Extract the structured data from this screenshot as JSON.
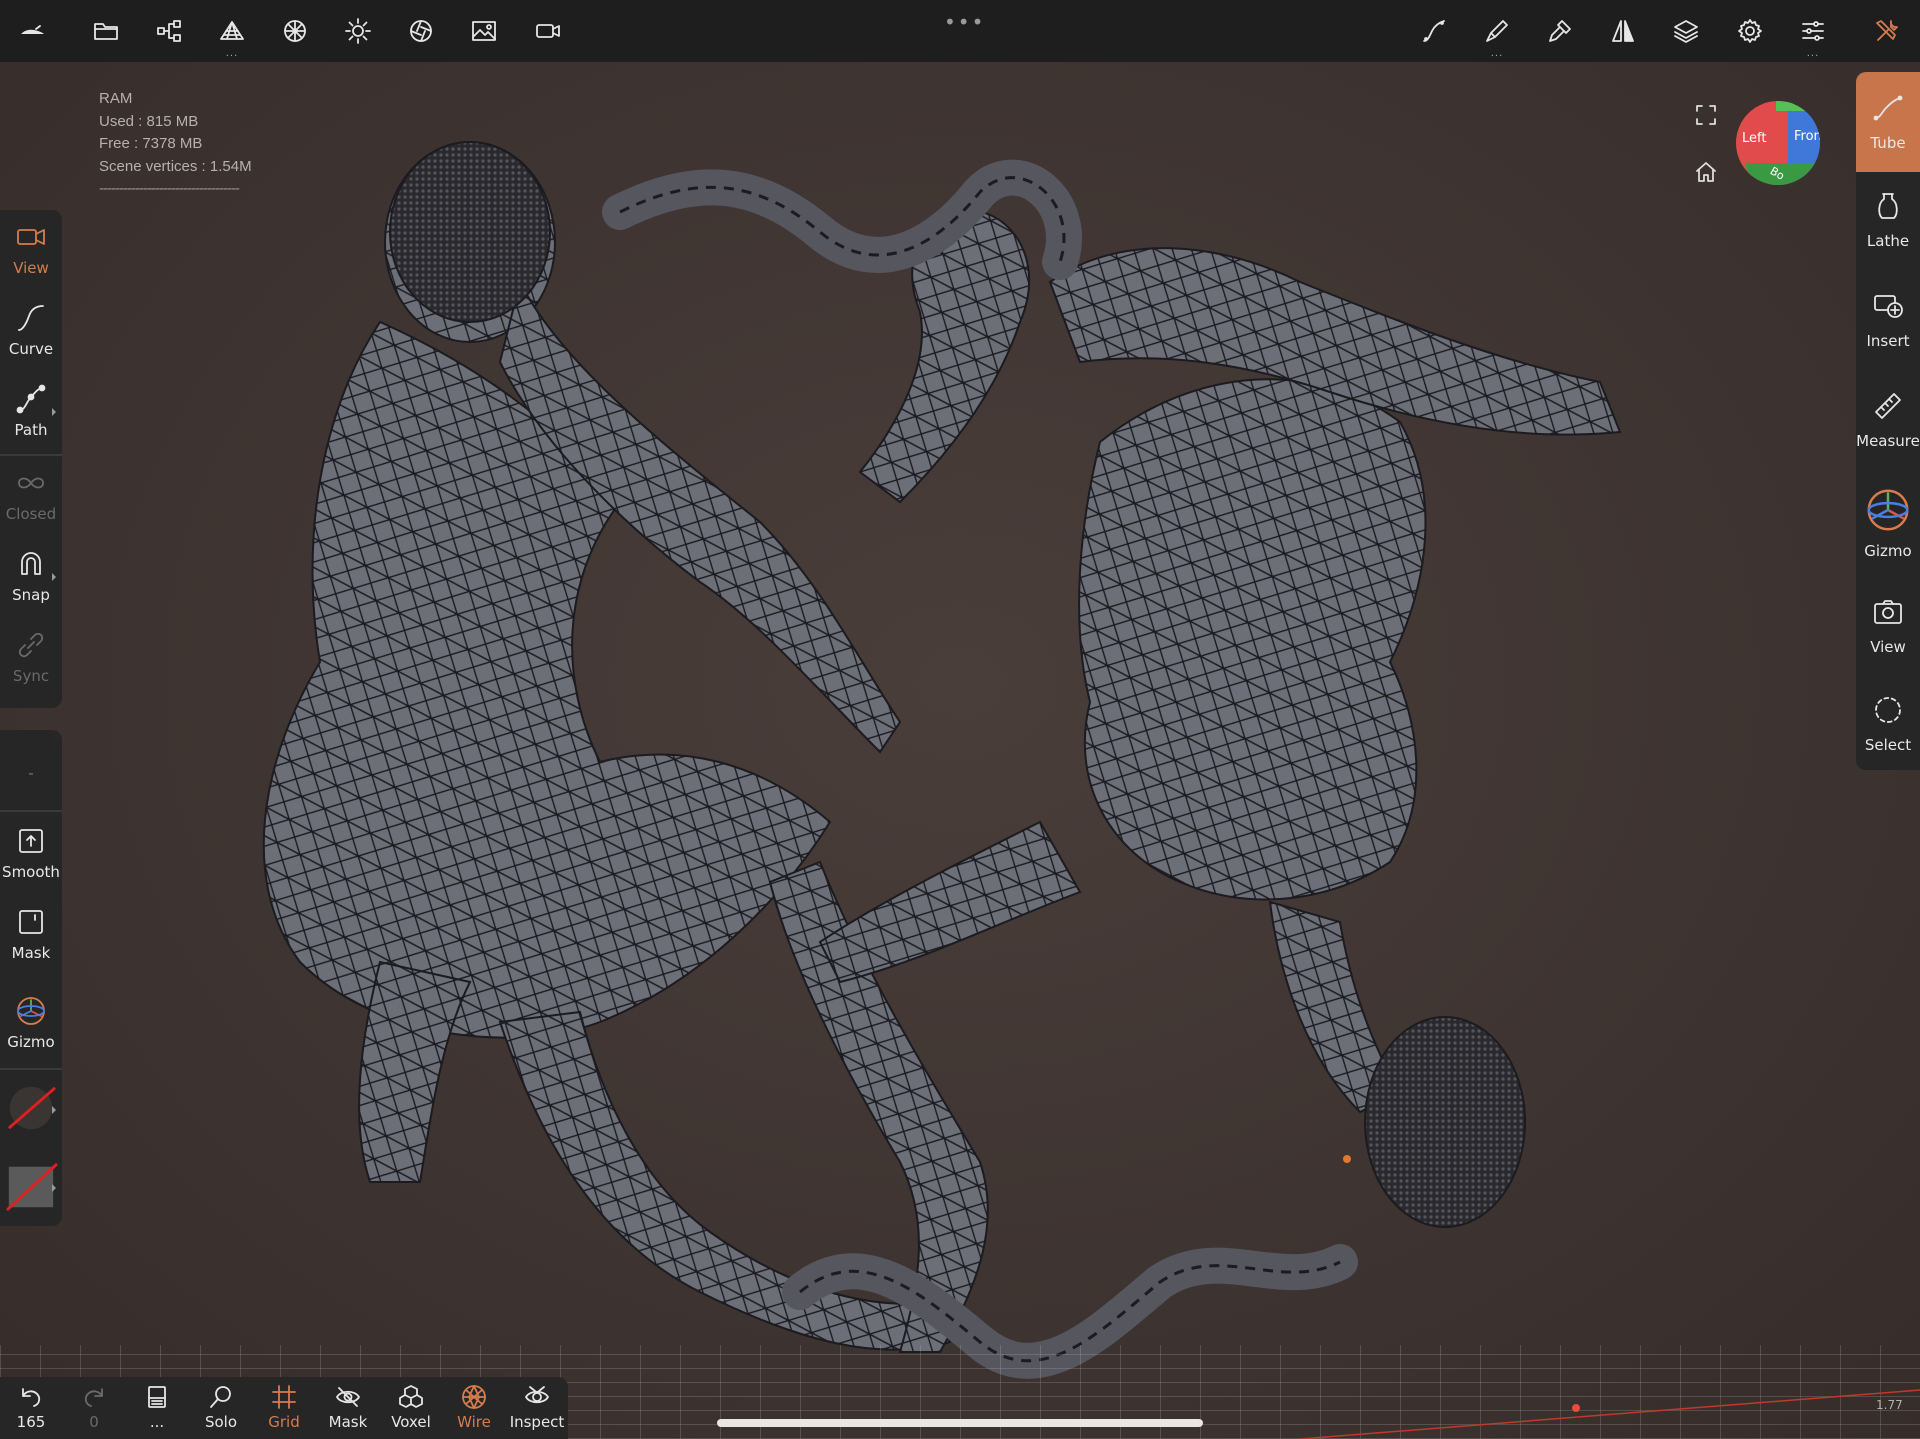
{
  "app": {
    "name": "Nomad Sculpt"
  },
  "topbar": {
    "left_icons": [
      "nomad-logo-icon",
      "folder-icon",
      "scene-graph-icon",
      "mesh-topology-icon",
      "material-sphere-icon",
      "light-sun-icon",
      "shading-icon",
      "background-image-icon",
      "camera-icon"
    ],
    "right_icons": [
      "stroke-icon",
      "brush-paint-icon",
      "material-pick-icon",
      "symmetry-icon",
      "layers-icon",
      "settings-gear-icon",
      "sliders-icon",
      "tools-wrench-icon"
    ]
  },
  "ram_info": {
    "title": "RAM",
    "used": "Used : 815 MB",
    "free": "Free : 7378 MB",
    "vertices": "Scene vertices : 1.54M",
    "separator": "-----------------------------------"
  },
  "left_toolbar": {
    "view": "View",
    "curve": "Curve",
    "path": "Path",
    "closed": "Closed",
    "snap": "Snap",
    "sync": "Sync",
    "dash": "-",
    "smooth": "Smooth",
    "mask": "Mask",
    "gizmo": "Gizmo"
  },
  "right_toolbar": {
    "tube": "Tube",
    "lathe": "Lathe",
    "insert": "Insert",
    "measure": "Measure",
    "gizmo": "Gizmo",
    "view": "View",
    "select": "Select"
  },
  "viewcube": {
    "left": "Left",
    "front": "Front",
    "bottom": "Bo"
  },
  "bottom_bar": {
    "undo_count": "165",
    "redo_count": "0",
    "more": "...",
    "solo": "Solo",
    "grid": "Grid",
    "mask": "Mask",
    "voxel": "Voxel",
    "wire": "Wire",
    "inspect": "Inspect"
  },
  "scale_value": "1.77",
  "colors": {
    "accent": "#d77c4d",
    "background": "#3f3431",
    "panel": "#262626"
  }
}
